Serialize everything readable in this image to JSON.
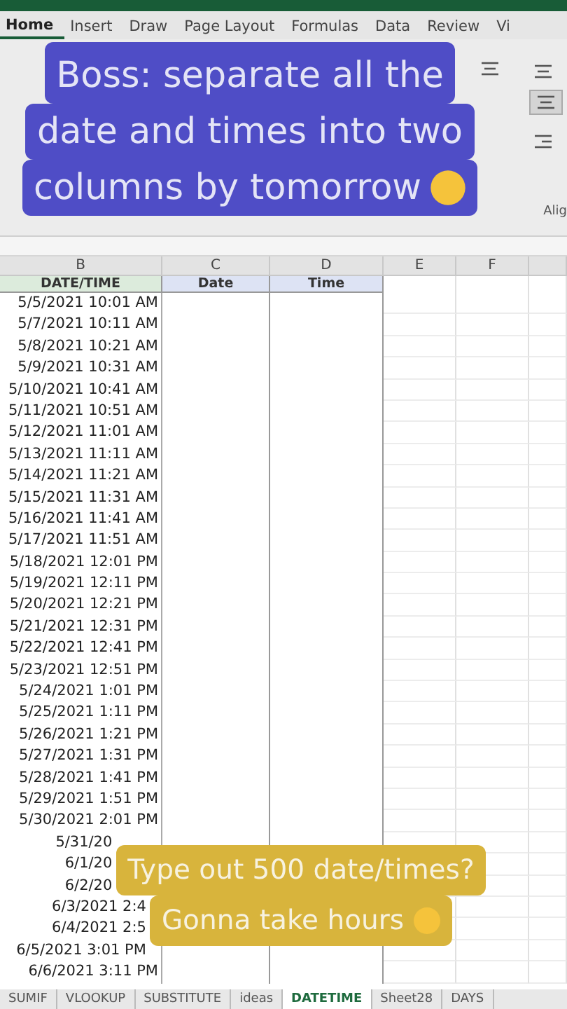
{
  "ribbon_tabs": [
    {
      "label": "Home",
      "selected": true
    },
    {
      "label": "Insert",
      "selected": false
    },
    {
      "label": "Draw",
      "selected": false
    },
    {
      "label": "Page Layout",
      "selected": false
    },
    {
      "label": "Formulas",
      "selected": false
    },
    {
      "label": "Data",
      "selected": false
    },
    {
      "label": "Review",
      "selected": false
    },
    {
      "label": "Vi",
      "selected": false
    }
  ],
  "ribbon": {
    "group_label": "Alig"
  },
  "columns": [
    "B",
    "C",
    "D",
    "E",
    "F"
  ],
  "header_row": [
    "DATE/TIME",
    "Date",
    "Time"
  ],
  "rows": [
    "5/5/2021 10:01 AM",
    "5/7/2021 10:11 AM",
    "5/8/2021 10:21 AM",
    "5/9/2021 10:31 AM",
    "5/10/2021 10:41 AM",
    "5/11/2021 10:51 AM",
    "5/12/2021 11:01 AM",
    "5/13/2021 11:11 AM",
    "5/14/2021 11:21 AM",
    "5/15/2021 11:31 AM",
    "5/16/2021 11:41 AM",
    "5/17/2021 11:51 AM",
    "5/18/2021 12:01 PM",
    "5/19/2021 12:11 PM",
    "5/20/2021 12:21 PM",
    "5/21/2021 12:31 PM",
    "5/22/2021 12:41 PM",
    "5/23/2021 12:51 PM",
    "5/24/2021 1:01 PM",
    "5/25/2021 1:11 PM",
    "5/26/2021 1:21 PM",
    "5/27/2021 1:31 PM",
    "5/28/2021 1:41 PM",
    "5/29/2021 1:51 PM",
    "5/30/2021 2:01 PM",
    "5/31/20",
    "6/1/20",
    "6/2/20",
    "6/3/2021 2:4",
    "6/4/2021 2:5",
    "6/5/2021 3:01 PM",
    "6/6/2021 3:11 PM"
  ],
  "sheet_tabs": [
    {
      "label": "SUMIF",
      "selected": false
    },
    {
      "label": "VLOOKUP",
      "selected": false
    },
    {
      "label": "SUBSTITUTE",
      "selected": false
    },
    {
      "label": "ideas",
      "selected": false
    },
    {
      "label": "DATETIME",
      "selected": true
    },
    {
      "label": "Sheet28",
      "selected": false
    },
    {
      "label": "DAYS",
      "selected": false
    }
  ],
  "captions": [
    {
      "kind": "purple",
      "lines": [
        "Boss: separate all the",
        "date and times into two",
        "columns by tomorrow"
      ]
    },
    {
      "kind": "gold",
      "lines": [
        "Type out 500 date/times?",
        "Gonna take hours"
      ]
    }
  ]
}
